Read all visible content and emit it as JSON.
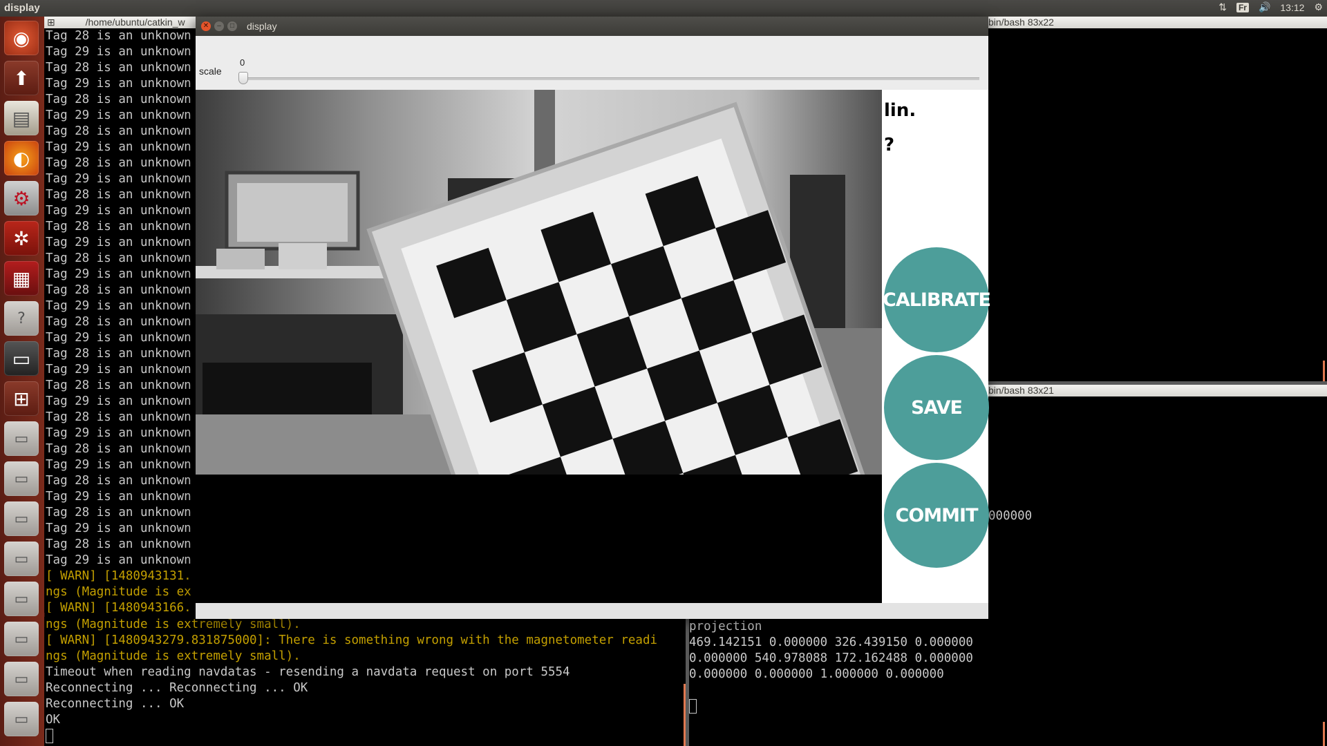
{
  "top_panel": {
    "app_title": "display",
    "keyboard_layout": "Fr",
    "clock": "13:12"
  },
  "launcher": {
    "icons": [
      "ubuntu-dash-icon",
      "software-updater-icon",
      "files-icon",
      "firefox-icon",
      "system-settings-icon",
      "rviz-icon",
      "monitor-app-icon",
      "help-icon",
      "terminal-icon",
      "workspace-switcher-icon",
      "drive-icon",
      "drive-icon",
      "drive-icon",
      "drive-icon",
      "drive-icon",
      "drive-icon",
      "drive-icon",
      "drive-icon",
      "drive-icon"
    ]
  },
  "terminals": {
    "left": {
      "title": "/home/ubuntu/catkin_w",
      "lines": [
        {
          "text": "Tag 28 is an unknown",
          "type": "normal"
        },
        {
          "text": "Tag 29 is an unknown",
          "type": "normal"
        },
        {
          "text": "Tag 28 is an unknown",
          "type": "normal"
        },
        {
          "text": "Tag 29 is an unknown",
          "type": "normal"
        },
        {
          "text": "Tag 28 is an unknown",
          "type": "normal"
        },
        {
          "text": "Tag 29 is an unknown",
          "type": "normal"
        },
        {
          "text": "Tag 28 is an unknown",
          "type": "normal"
        },
        {
          "text": "Tag 29 is an unknown",
          "type": "normal"
        },
        {
          "text": "Tag 28 is an unknown",
          "type": "normal"
        },
        {
          "text": "Tag 29 is an unknown",
          "type": "normal"
        },
        {
          "text": "Tag 28 is an unknown",
          "type": "normal"
        },
        {
          "text": "Tag 29 is an unknown",
          "type": "normal"
        },
        {
          "text": "Tag 28 is an unknown",
          "type": "normal"
        },
        {
          "text": "Tag 29 is an unknown",
          "type": "normal"
        },
        {
          "text": "Tag 28 is an unknown",
          "type": "normal"
        },
        {
          "text": "Tag 29 is an unknown",
          "type": "normal"
        },
        {
          "text": "Tag 28 is an unknown",
          "type": "normal"
        },
        {
          "text": "Tag 29 is an unknown",
          "type": "normal"
        },
        {
          "text": "Tag 28 is an unknown",
          "type": "normal"
        },
        {
          "text": "Tag 29 is an unknown",
          "type": "normal"
        },
        {
          "text": "Tag 28 is an unknown",
          "type": "normal"
        },
        {
          "text": "Tag 29 is an unknown",
          "type": "normal"
        },
        {
          "text": "Tag 28 is an unknown",
          "type": "normal"
        },
        {
          "text": "Tag 29 is an unknown",
          "type": "normal"
        },
        {
          "text": "Tag 28 is an unknown",
          "type": "normal"
        },
        {
          "text": "Tag 29 is an unknown",
          "type": "normal"
        },
        {
          "text": "Tag 28 is an unknown",
          "type": "normal"
        },
        {
          "text": "Tag 29 is an unknown",
          "type": "normal"
        },
        {
          "text": "Tag 28 is an unknown",
          "type": "normal"
        },
        {
          "text": "Tag 29 is an unknown",
          "type": "normal"
        },
        {
          "text": "Tag 28 is an unknown",
          "type": "normal"
        },
        {
          "text": "Tag 29 is an unknown",
          "type": "normal"
        },
        {
          "text": "Tag 28 is an unknown",
          "type": "normal"
        },
        {
          "text": "Tag 29 is an unknown",
          "type": "normal"
        },
        {
          "text": "[ WARN] [1480943131.",
          "type": "warn"
        },
        {
          "text": "ngs (Magnitude is ex",
          "type": "warn"
        },
        {
          "text": "[ WARN] [1480943166.",
          "type": "warn"
        }
      ],
      "bottom_lines": [
        {
          "text": "ngs (Magnitude is extremely small).",
          "type": "warn"
        },
        {
          "text": "[ WARN] [1480943279.831875000]: There is something wrong with the magnetometer readi",
          "type": "warn"
        },
        {
          "text": "ngs (Magnitude is extremely small).",
          "type": "warn"
        },
        {
          "text": "Timeout when reading navdatas - resending a navdata request on port 5554",
          "type": "normal"
        },
        {
          "text": "Reconnecting ... Reconnecting ... OK",
          "type": "normal"
        },
        {
          "text": "Reconnecting ... OK",
          "type": "normal"
        },
        {
          "text": "OK",
          "type": "normal"
        }
      ]
    },
    "right_top": {
      "title": "bin/bash 83x22"
    },
    "right_middle": {
      "title": "bin/bash 83x21",
      "partial_text": "000000"
    },
    "right_bottom": {
      "lines": [
        "projection",
        "469.142151 0.000000 326.439150 0.000000",
        "0.000000 540.978088 172.162488 0.000000",
        "0.000000 0.000000 1.000000 0.000000"
      ]
    }
  },
  "display_window": {
    "title": "display",
    "slider": {
      "label": "scale",
      "value": "0"
    },
    "side_panel": {
      "text_line1": "lin.",
      "text_line2": "?",
      "buttons": {
        "calibrate": "CALIBRATE",
        "save": "SAVE",
        "commit": "COMMIT"
      }
    },
    "colors": {
      "button_teal": "#4d9e9a",
      "titlebar": "#3c3b37",
      "close_button": "#e4542a",
      "warn_text": "#c4a000",
      "launcher": "#6b2416"
    }
  }
}
